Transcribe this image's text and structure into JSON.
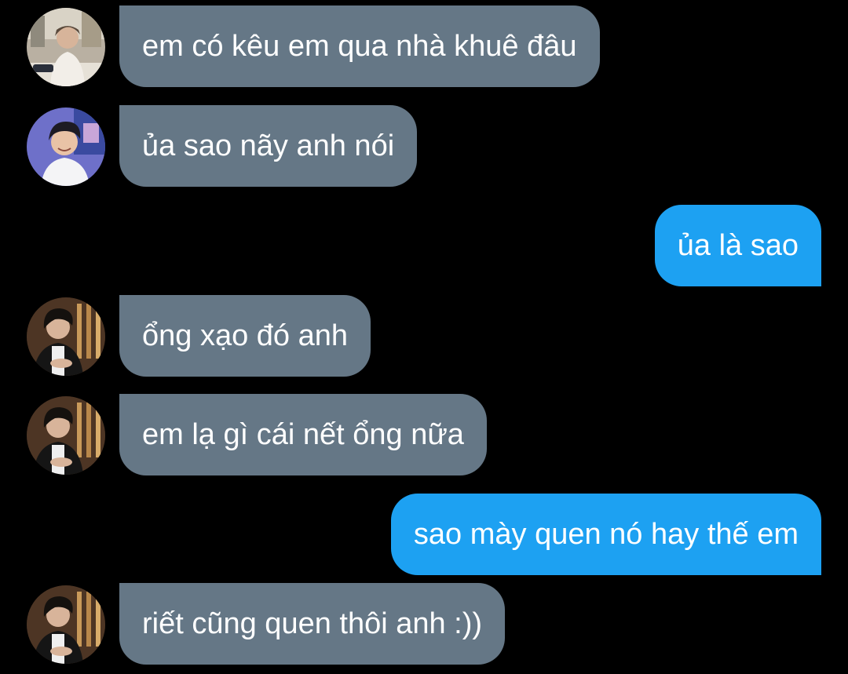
{
  "colors": {
    "background": "#000000",
    "incoming_bubble": "#657786",
    "outgoing_bubble": "#1da1f2",
    "text": "#ffffff"
  },
  "messages": [
    {
      "direction": "incoming",
      "avatar": "avatar-photo-a",
      "text": "em có kêu em qua nhà khuê đâu"
    },
    {
      "direction": "incoming",
      "avatar": "avatar-photo-b",
      "text": "ủa sao nãy anh nói"
    },
    {
      "direction": "outgoing",
      "text": "ủa là sao"
    },
    {
      "direction": "incoming",
      "avatar": "avatar-photo-c",
      "text": "ổng xạo đó anh"
    },
    {
      "direction": "incoming",
      "avatar": "avatar-photo-c",
      "text": "em lạ gì cái nết ổng nữa"
    },
    {
      "direction": "outgoing",
      "text": "sao mày quen nó hay thế em"
    },
    {
      "direction": "incoming",
      "avatar": "avatar-photo-c",
      "text": "riết cũng quen thôi anh :))"
    }
  ]
}
